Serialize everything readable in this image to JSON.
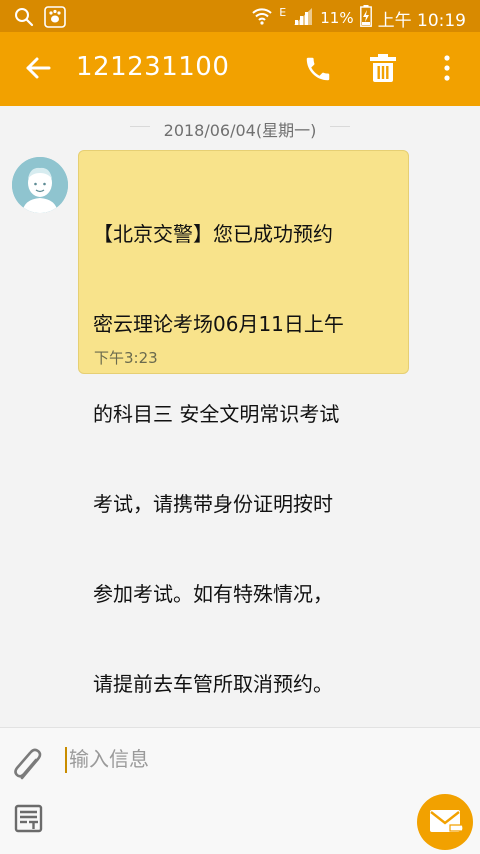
{
  "status_bar": {
    "battery": "11%",
    "time": "上午 10:19",
    "network": "E",
    "icons": [
      "search-icon",
      "baidu-paw-icon",
      "wifi-icon",
      "signal-icon",
      "battery-charging-icon"
    ]
  },
  "header": {
    "title": "121231100",
    "back_icon": "arrow-left-icon",
    "actions": [
      "phone-icon",
      "trash-icon",
      "more-vertical-icon"
    ]
  },
  "conversation": {
    "date": "2018/06/04(星期一)",
    "messages": [
      {
        "lines": [
          "【北京交警】您已成功预约",
          "密云理论考场06月11日上午",
          "的科目三 安全文明常识考试",
          "考试，请携带身份证明按时",
          "参加考试。如有特殊情况，",
          "请提前去车管所取消预约。"
        ],
        "time": "下午3:23",
        "direction": "incoming"
      }
    ]
  },
  "composer": {
    "placeholder": "输入信息",
    "value": "",
    "icons": [
      "paperclip-icon",
      "template-icon",
      "send-icon"
    ]
  },
  "colors": {
    "status_bar": "#d88a00",
    "app_bar": "#f2a100",
    "bubble": "#f8e38b",
    "avatar": "#8fc4cf",
    "background": "#f3f3f3"
  }
}
